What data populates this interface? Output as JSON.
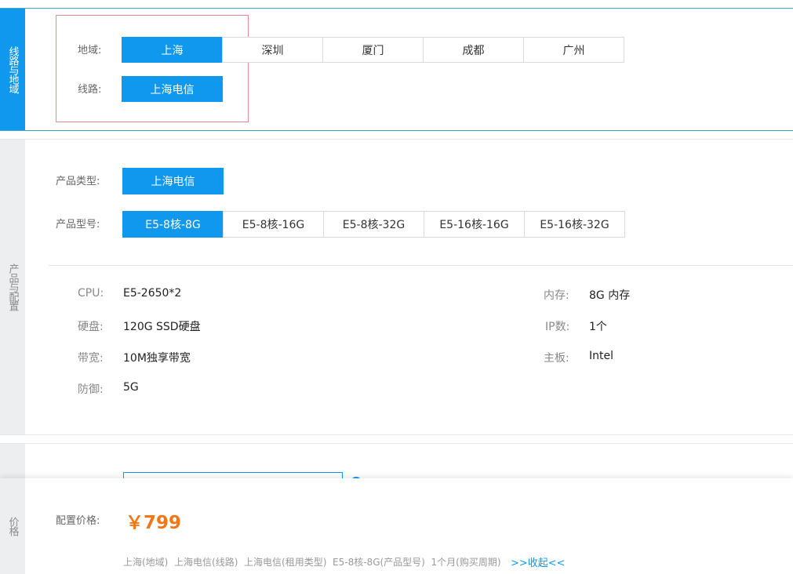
{
  "region": {
    "tab_label": "线路与地域",
    "area_label": "地域:",
    "areas": [
      "上海",
      "深圳",
      "厦门",
      "成都",
      "广州"
    ],
    "line_label": "线路:",
    "lines": [
      "上海电信"
    ]
  },
  "product": {
    "tab_label": "产品与配置",
    "type_label": "产品类型:",
    "types": [
      "上海电信"
    ],
    "model_label": "产品型号:",
    "models": [
      "E5-8核-8G",
      "E5-8核-16G",
      "E5-8核-32G",
      "E5-16核-16G",
      "E5-16核-32G"
    ],
    "specs": {
      "cpu_label": "CPU:",
      "cpu": "E5-2650*2",
      "disk_label": "硬盘:",
      "disk": "120G SSD硬盘",
      "bandwidth_label": "带宽:",
      "bandwidth": "10M独享带宽",
      "defense_label": "防御:",
      "defense": "5G",
      "memory_label": "内存:",
      "memory": "8G 内存",
      "ip_label": "IP数:",
      "ip": "1个",
      "board_label": "主板:",
      "board": "Intel"
    }
  },
  "price": {
    "tab_label": "价格",
    "label": "配置价格:",
    "amount": "￥799",
    "summary": [
      "上海(地域)",
      "上海电信(线路)",
      "上海电信(租用类型)",
      "E5-8核-8G(产品型号)",
      "1个月(购买周期)"
    ],
    "collapse": ">>收起<<"
  },
  "colors": {
    "accent": "#0f98ee",
    "price": "#f07818",
    "highlight_box": "#e8898f"
  }
}
